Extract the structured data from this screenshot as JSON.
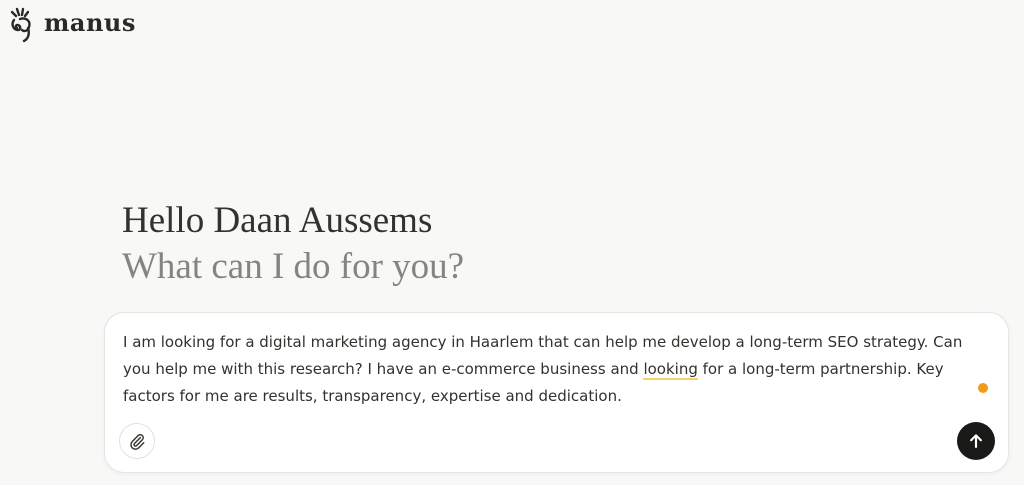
{
  "app": {
    "name": "manus"
  },
  "greeting": {
    "title": "Hello Daan Aussems",
    "subtitle": "What can I do for you?"
  },
  "composer": {
    "text_before": "I am looking for a digital marketing agency in Haarlem that can help me develop a long-term SEO strategy. Can you help me with this research? I have an e-commerce business and ",
    "text_highlight": "looking",
    "text_after": " for a long-term partnership. Key factors for me are results, transparency, expertise and dedication.",
    "attach_icon": "paperclip-icon",
    "send_icon": "arrow-up-icon",
    "status_dot_color": "#f29b18",
    "send_button_color": "#1a1a19",
    "spellcheck_underline_color": "#f2d36b"
  }
}
